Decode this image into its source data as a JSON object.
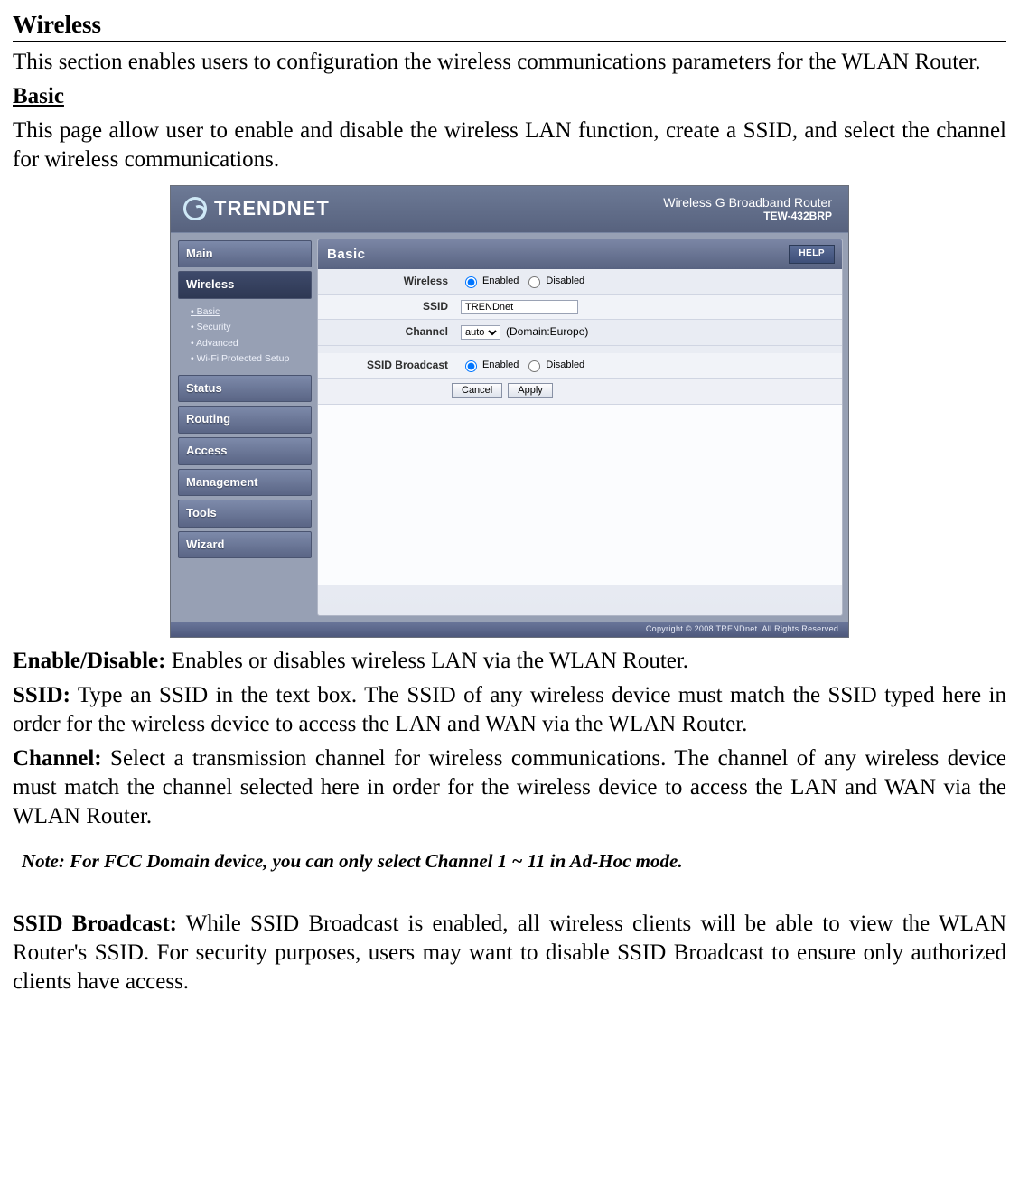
{
  "doc": {
    "h1": "Wireless",
    "intro": "This section enables users to configuration the wireless communications parameters for the WLAN Router.",
    "h2": "Basic",
    "basic_intro": "This page allow user to enable and disable the wireless LAN function, create a SSID, and select the channel for wireless communications.",
    "enable_label": "Enable/Disable:",
    "enable_text": " Enables or disables wireless LAN via the WLAN Router.",
    "ssid_label": "SSID:",
    "ssid_text": " Type an SSID in the text box. The SSID of any wireless device must match the SSID typed here in order for the wireless device to access the LAN and WAN via the WLAN Router.",
    "channel_label": "Channel:",
    "channel_text": " Select a transmission channel for wireless communications. The channel of any wireless device must match the channel selected here in order for the wireless device to access the LAN and WAN via the WLAN Router.",
    "note": "Note: For FCC Domain device, you can only select Channel 1 ~ 11 in Ad-Hoc mode.",
    "ssid_bcast_label": "SSID Broadcast:",
    "ssid_bcast_text": " While SSID Broadcast is enabled, all wireless clients will be able to view the WLAN Router's SSID. For security purposes, users may want to disable SSID Broadcast to ensure only authorized clients have access."
  },
  "router": {
    "brand": "TRENDNET",
    "product_line1": "Wireless G Broadband Router",
    "product_line2": "TEW-432BRP",
    "nav": {
      "main": "Main",
      "wireless": "Wireless",
      "sub": {
        "basic": "Basic",
        "security": "Security",
        "advanced": "Advanced",
        "wps": "Wi-Fi Protected Setup"
      },
      "status": "Status",
      "routing": "Routing",
      "access": "Access",
      "management": "Management",
      "tools": "Tools",
      "wizard": "Wizard"
    },
    "panel": {
      "title": "Basic",
      "help": "HELP",
      "rows": {
        "wireless_label": "Wireless",
        "ssid_label": "SSID",
        "channel_label": "Channel",
        "ssid_bcast_label": "SSID Broadcast"
      },
      "enabled": "Enabled",
      "disabled": "Disabled",
      "ssid_value": "TRENDnet",
      "channel_value": "auto",
      "channel_suffix": "(Domain:Europe)",
      "cancel": "Cancel",
      "apply": "Apply"
    },
    "footer": "Copyright © 2008 TRENDnet. All Rights Reserved."
  }
}
